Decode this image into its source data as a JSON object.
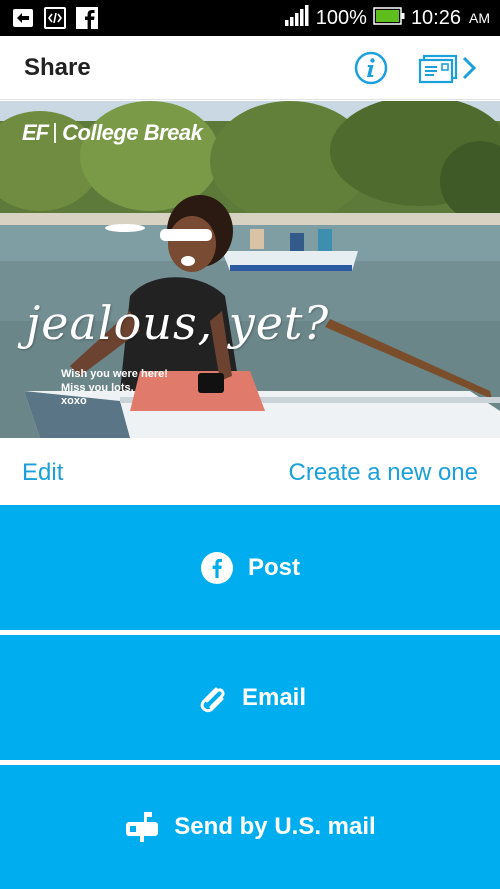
{
  "status_bar": {
    "battery_percent": "100%",
    "time": "10:26",
    "ampm": "AM",
    "icons": [
      "usb-debug-icon",
      "code-icon",
      "facebook-icon",
      "signal-icon",
      "battery-icon"
    ]
  },
  "header": {
    "title": "Share",
    "info_icon": "info-icon",
    "postcard_icon": "postcard-icon"
  },
  "postcard": {
    "brand_ef": "EF",
    "brand_name": "College Break",
    "headline": "jealous, yet?",
    "note_lines": [
      "Wish you were here!",
      "Miss you lots,",
      "xoxo"
    ]
  },
  "edit_row": {
    "edit_label": "Edit",
    "create_label": "Create a new one"
  },
  "actions": {
    "post_label": "Post",
    "email_label": "Email",
    "mail_label": "Send by U.S. mail"
  },
  "colors": {
    "accent": "#00aeef",
    "link": "#1aa1dc",
    "header_text": "#222222"
  }
}
